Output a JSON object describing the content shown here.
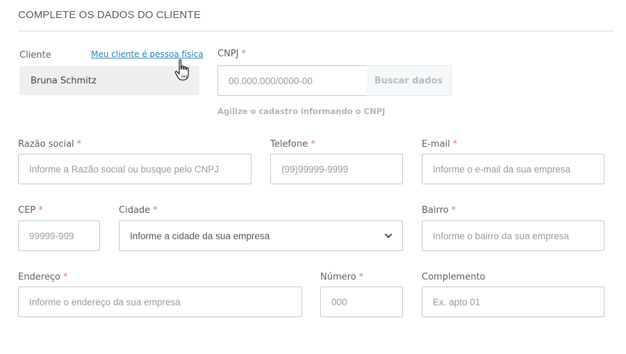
{
  "section": {
    "title": "COMPLETE OS DADOS DO CLIENTE"
  },
  "cliente": {
    "label": "Cliente",
    "value": "Bruna Schmitz",
    "link": "Meu cliente é pessoa física"
  },
  "cnpj": {
    "label": "CNPJ",
    "placeholder": "00.000.000/0000-00",
    "button": "Buscar dados",
    "hint": "Agilize o cadastro informando o CNPJ"
  },
  "razao": {
    "label": "Razão social",
    "placeholder": "Informe a Razão social ou busque pelo CNPJ"
  },
  "telefone": {
    "label": "Telefone",
    "placeholder": "(99)99999-9999"
  },
  "email": {
    "label": "E-mail",
    "placeholder": "Informe o e-mail da sua empresa"
  },
  "cep": {
    "label": "CEP",
    "placeholder": "99999-999"
  },
  "cidade": {
    "label": "Cidade",
    "selected": "Informe a cidade da sua empresa"
  },
  "bairro": {
    "label": "Bairro",
    "placeholder": "Informe o bairro da sua empresa"
  },
  "endereco": {
    "label": "Endereço",
    "placeholder": "Informe o endereço da sua empresa"
  },
  "numero": {
    "label": "Número",
    "placeholder": "000"
  },
  "complemento": {
    "label": "Complemento",
    "placeholder": "Ex. apto 01"
  },
  "required_mark": "*",
  "icons": {
    "cursor": "hand-pointer-icon",
    "dropdown": "chevron-down-icon"
  },
  "colors": {
    "required": "#e07b53",
    "link": "#2b7fa8",
    "border": "#c8c8c8"
  }
}
